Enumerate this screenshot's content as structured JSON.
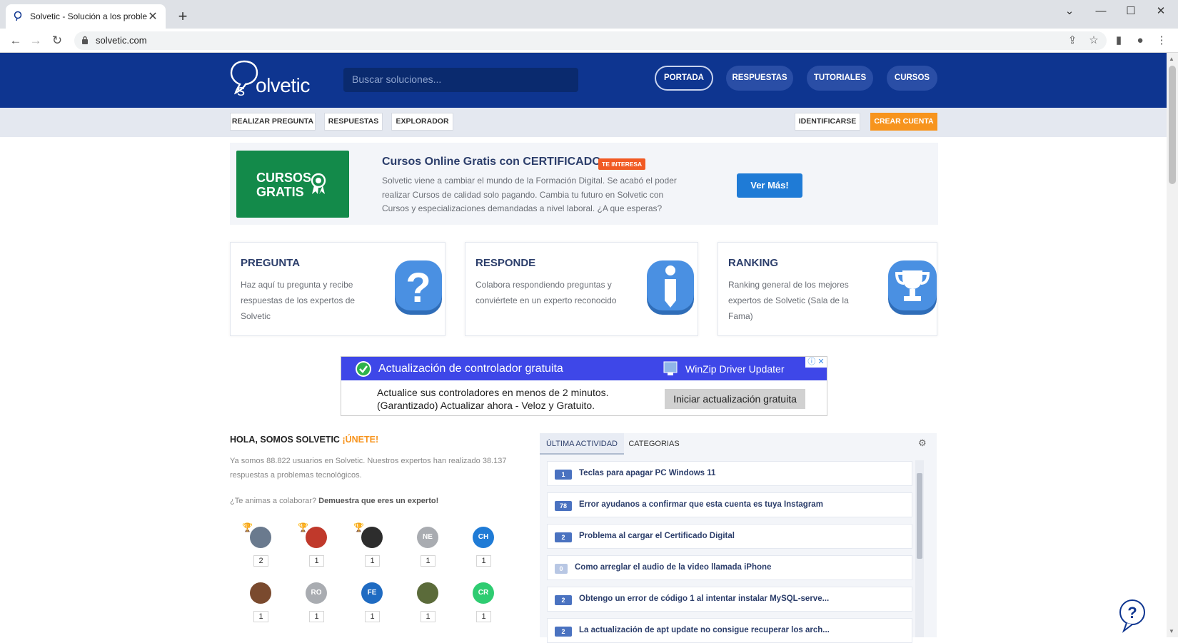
{
  "browser": {
    "tab_title": "Solvetic - Solución a los problem",
    "url": "solvetic.com"
  },
  "header": {
    "logo_text": "olvetic",
    "search_placeholder": "Buscar soluciones...",
    "nav": [
      "PORTADA",
      "RESPUESTAS",
      "TUTORIALES",
      "CURSOS"
    ]
  },
  "subnav": {
    "left": [
      "REALIZAR PREGUNTA",
      "RESPUESTAS",
      "EXPLORADOR"
    ],
    "login": "IDENTIFICARSE",
    "signup": "CREAR CUENTA"
  },
  "promo": {
    "image_text_1": "CURSOS",
    "image_text_2": "GRATIS",
    "title": "Cursos Online Gratis con CERTIFICADO",
    "badge": "TE INTERESA",
    "description": "Solvetic viene a cambiar el mundo de la Formación Digital. Se acabó el poder realizar Cursos de calidad solo pagando. Cambia tu futuro en Solvetic con Cursos y especializaciones demandadas a nivel laboral. ¿A que esperas?",
    "button": "Ver Más!"
  },
  "cards": [
    {
      "title": "PREGUNTA",
      "desc": "Haz aquí tu pregunta y recibe respuestas de los expertos de Solvetic"
    },
    {
      "title": "RESPONDE",
      "desc": "Colabora respondiendo preguntas y conviértete en un experto reconocido"
    },
    {
      "title": "RANKING",
      "desc": "Ranking general de los mejores expertos de Solvetic (Sala de la Fama)"
    }
  ],
  "ad": {
    "title": "Actualización de controlador gratuita",
    "brand": "WinZip Driver Updater",
    "desc_line1": "Actualice sus controladores en menos de 2 minutos.",
    "desc_line2": "(Garantizado) Actualizar ahora - Veloz y Gratuito.",
    "button": "Iniciar actualización gratuita"
  },
  "community": {
    "heading": "HOLA, SOMOS SOLVETIC",
    "join": "¡ÚNETE!",
    "stats": "Ya somos 88.822 usuarios en Solvetic. Nuestros expertos han realizado 38.137 respuestas a problemas tecnológicos.",
    "cta_question": "¿Te animas a colaborar?",
    "cta_bold": "Demuestra que eres un experto!",
    "users": [
      {
        "initials": "",
        "score": "2",
        "color": "#6a7a8e",
        "trophy": "gold"
      },
      {
        "initials": "",
        "score": "1",
        "color": "#c0392b",
        "trophy": "silver"
      },
      {
        "initials": "",
        "score": "1",
        "color": "#2d2d2d",
        "trophy": "bronze"
      },
      {
        "initials": "NE",
        "score": "1",
        "color": "#a9acb1",
        "trophy": ""
      },
      {
        "initials": "CH",
        "score": "1",
        "color": "#1f7bd6",
        "trophy": ""
      },
      {
        "initials": "",
        "score": "1",
        "color": "#7a4a2e",
        "trophy": ""
      },
      {
        "initials": "RO",
        "score": "1",
        "color": "#a9acb1",
        "trophy": ""
      },
      {
        "initials": "FE",
        "score": "1",
        "color": "#1f6bc2",
        "trophy": ""
      },
      {
        "initials": "",
        "score": "1",
        "color": "#5b6b3a",
        "trophy": ""
      },
      {
        "initials": "CR",
        "score": "1",
        "color": "#2ecc71",
        "trophy": ""
      }
    ]
  },
  "activity": {
    "tabs": [
      "ÚLTIMA ACTIVIDAD",
      "CATEGORIAS"
    ],
    "items": [
      {
        "count": "1",
        "text": "Teclas para apagar PC Windows 11"
      },
      {
        "count": "78",
        "text": "Error ayudanos a confirmar que esta cuenta es tuya Instagram"
      },
      {
        "count": "2",
        "text": "Problema al cargar el Certificado Digital"
      },
      {
        "count": "0",
        "text": "Como arreglar el audio de la video llamada iPhone"
      },
      {
        "count": "2",
        "text": "Obtengo un error de código 1 al intentar instalar MySQL-serve..."
      },
      {
        "count": "2",
        "text": "La actualización de apt update no consigue recuperar los arch..."
      }
    ]
  }
}
